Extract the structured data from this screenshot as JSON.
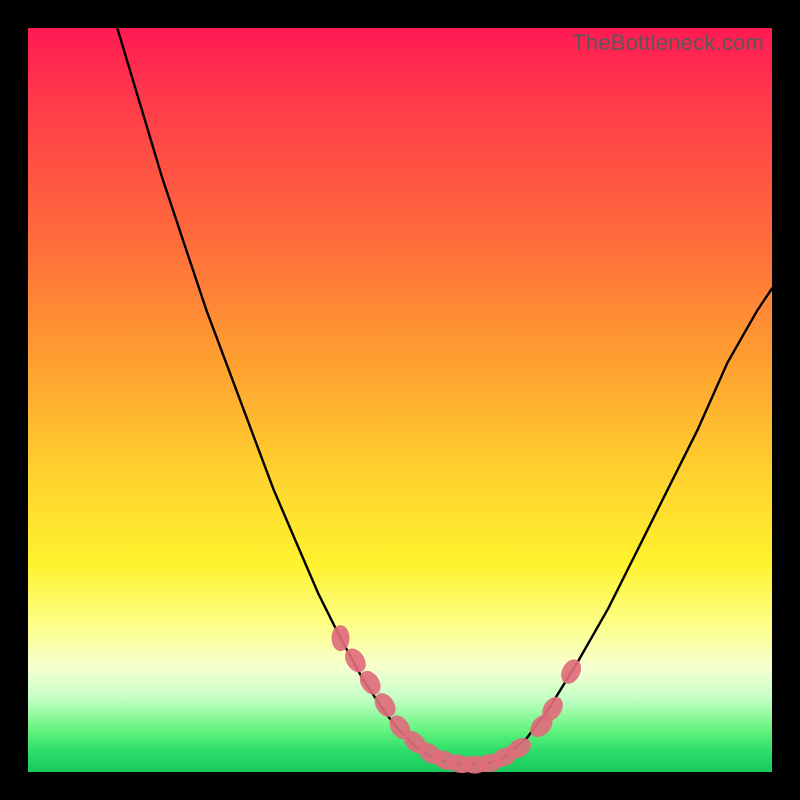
{
  "watermark": "TheBottleneck.com",
  "chart_data": {
    "type": "line",
    "title": "",
    "xlabel": "",
    "ylabel": "",
    "xlim": [
      0,
      100
    ],
    "ylim": [
      0,
      100
    ],
    "series": [
      {
        "name": "bottleneck-curve",
        "x": [
          12,
          15,
          18,
          21,
          24,
          27,
          30,
          33,
          36,
          39,
          42,
          45,
          48,
          50,
          52,
          54,
          56,
          58,
          60,
          62,
          64,
          67,
          70,
          74,
          78,
          82,
          86,
          90,
          94,
          98,
          100
        ],
        "values": [
          100,
          90,
          80,
          71,
          62,
          54,
          46,
          38,
          31,
          24,
          18,
          12.5,
          8,
          5.5,
          3.5,
          2.2,
          1.4,
          1.0,
          1.0,
          1.2,
          2.0,
          4.5,
          8.5,
          15,
          22,
          30,
          38,
          46,
          55,
          62,
          65
        ]
      }
    ],
    "markers": {
      "name": "highlight-points",
      "color": "#e06c7c",
      "x": [
        42,
        44,
        46,
        48,
        50,
        52,
        54,
        56,
        58,
        60,
        62,
        64,
        66,
        69,
        70.5,
        73
      ],
      "values": [
        18,
        15,
        12,
        9,
        6,
        4,
        2.5,
        1.6,
        1.1,
        1.0,
        1.2,
        2.0,
        3.2,
        6.2,
        8.5,
        13.5
      ]
    },
    "gradient_stops": [
      {
        "pos": 0,
        "color": "#ff1a53"
      },
      {
        "pos": 28,
        "color": "#ff6a3c"
      },
      {
        "pos": 60,
        "color": "#ffd22e"
      },
      {
        "pos": 80,
        "color": "#fdff86"
      },
      {
        "pos": 94,
        "color": "#6cf583"
      },
      {
        "pos": 100,
        "color": "#18c95d"
      }
    ]
  }
}
